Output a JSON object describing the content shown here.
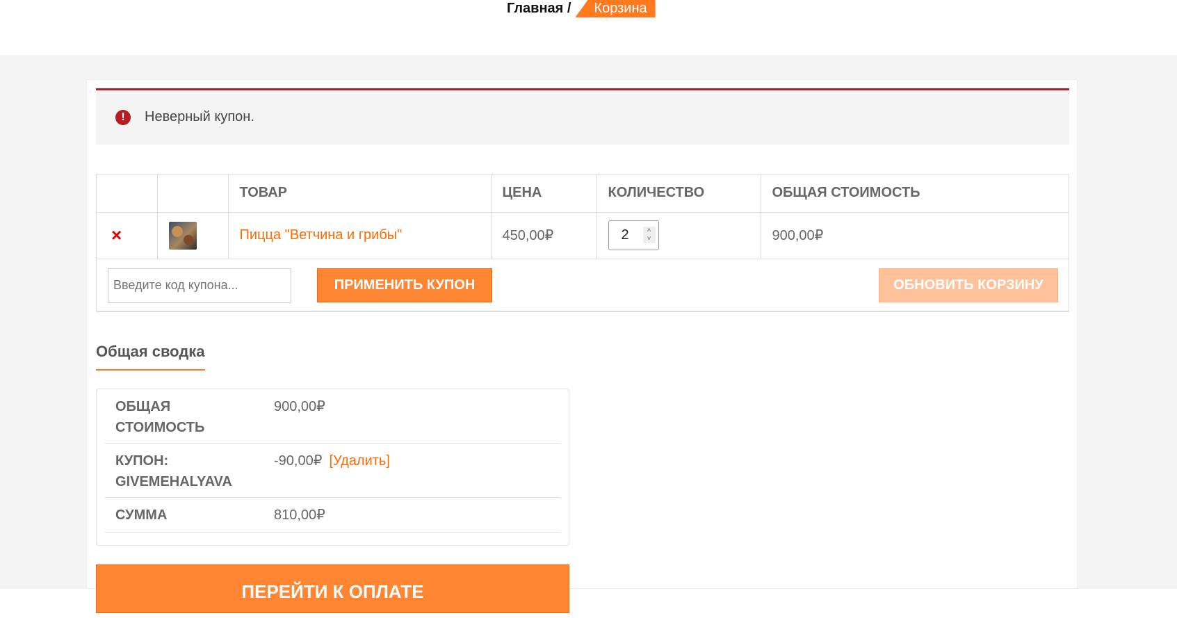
{
  "breadcrumb": {
    "home": "Главная /",
    "current": "Корзина"
  },
  "notice": {
    "icon": "error-icon",
    "text": "Неверный купон."
  },
  "cart": {
    "headers": [
      "",
      "",
      "ТОВАР",
      "ЦЕНА",
      "КОЛИЧЕСТВО",
      "ОБЩАЯ СТОИМОСТЬ"
    ],
    "items": [
      {
        "remove": "×",
        "product": "Пицца \"Ветчина и грибы\"",
        "price": "450,00₽",
        "quantity": "2",
        "subtotal": "900,00₽"
      }
    ],
    "coupon_placeholder": "Введите код купона...",
    "apply_label": "ПРИМЕНИТЬ КУПОН",
    "update_label": "ОБНОВИТЬ КОРЗИНУ"
  },
  "summary": {
    "title": "Общая сводка",
    "subtotal_label": "ОБЩАЯ СТОИМОСТЬ",
    "subtotal_value": "900,00₽",
    "coupon_label": "КУПОН: GIVEMEHALYAVA",
    "coupon_value": "-90,00₽",
    "coupon_remove": "[Удалить]",
    "total_label": "СУММА",
    "total_value": "810,00₽",
    "checkout_label": "ПЕРЕЙТИ К ОПЛАТЕ"
  },
  "colors": {
    "accent": "#ff7a1f",
    "error": "#b81c23"
  }
}
